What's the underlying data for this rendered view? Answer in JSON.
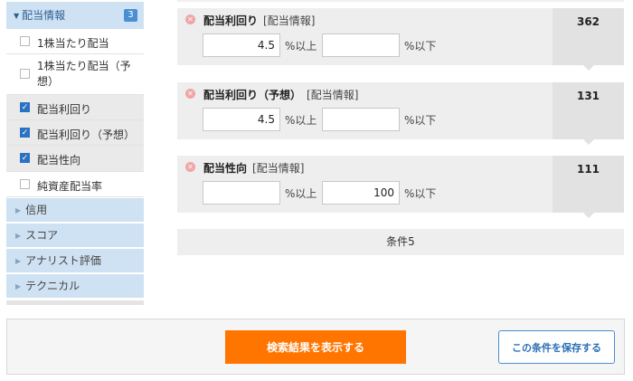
{
  "sidebar": {
    "section": {
      "label": "配当情報",
      "count": "3"
    },
    "options": [
      {
        "label": "1株当たり配当",
        "checked": false
      },
      {
        "label": "1株当たり配当（予\n想）",
        "checked": false
      },
      {
        "label": "配当利回り",
        "checked": true
      },
      {
        "label": "配当利回り（予想）",
        "checked": true
      },
      {
        "label": "配当性向",
        "checked": true
      },
      {
        "label": "純資産配当率",
        "checked": false
      }
    ],
    "categories": [
      "信用",
      "スコア",
      "アナリスト評価",
      "テクニカル"
    ]
  },
  "conditions": [
    {
      "title": "配当利回り",
      "tag": "[配当情報]",
      "min": "4.5",
      "max": "",
      "min_unit": "%以上",
      "max_unit": "%以下",
      "count": "362"
    },
    {
      "title": "配当利回り（予想）",
      "tag": "[配当情報]",
      "min": "4.5",
      "max": "",
      "min_unit": "%以上",
      "max_unit": "%以下",
      "count": "131"
    },
    {
      "title": "配当性向",
      "tag": "[配当情報]",
      "min": "",
      "max": "100",
      "min_unit": "%以上",
      "max_unit": "%以下",
      "count": "111"
    }
  ],
  "summary": "条件5",
  "footer": {
    "search_label": "検索結果を表示する",
    "save_label": "この条件を保存する"
  },
  "colors": {
    "accent_orange": "#ff7500",
    "accent_blue": "#2b73c2",
    "sidebar_header": "#cfe2f3"
  },
  "icons": {
    "section_toggle": "caret-down-icon",
    "category_toggle": "caret-right-icon",
    "remove": "close-circle-icon"
  }
}
